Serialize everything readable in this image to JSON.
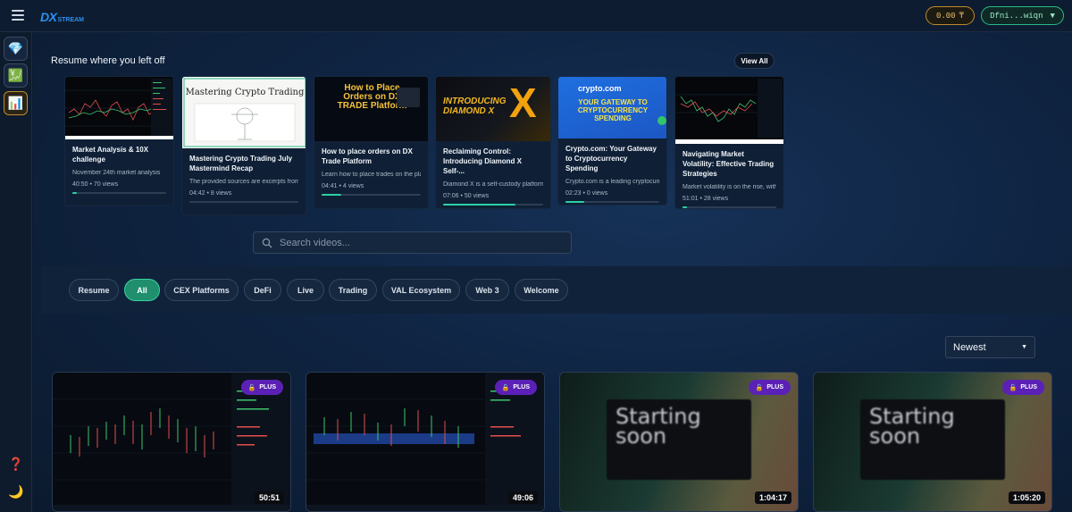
{
  "header": {
    "logo_main": "DX",
    "logo_sub": "STREAM",
    "balance": "0.00",
    "balance_icon": "token-icon",
    "wallet": "Dfni...wiqn",
    "wallet_chevron": "▼"
  },
  "sidebar": {
    "items": [
      {
        "name": "diamond",
        "icon": "💎"
      },
      {
        "name": "chart",
        "icon": "💹"
      },
      {
        "name": "dashboard",
        "icon": "📊"
      }
    ],
    "help_icon": "❓",
    "theme_icon": "🌙"
  },
  "resume": {
    "title": "Resume where you left off",
    "view_all": "View All",
    "cards": [
      {
        "title": "Market Analysis & 10X challenge",
        "desc": "November 24th market analysis",
        "duration": "40:50",
        "views": "70 views",
        "progress": 0.05,
        "thumb_text": ""
      },
      {
        "title": "Mastering Crypto Trading July Mastermind Recap",
        "desc": "The provided sources are excerpts from",
        "duration": "04:42",
        "views": "8 views",
        "progress": 0.0,
        "thumb_text": "Mastering Crypto Trading"
      },
      {
        "title": "How to place orders on DX Trade Platform",
        "desc": "Learn how to place trades on the platform",
        "duration": "04:41",
        "views": "4 views",
        "progress": 0.2,
        "thumb_text": "How to Place Orders on DX TRADE Platform"
      },
      {
        "title": "Reclaiming Control: Introducing Diamond X Self-...",
        "desc": "Diamond X is a self-custody platform",
        "duration": "07:06",
        "views": "50 views",
        "progress": 0.72,
        "thumb_text": "INTRODUCING DIAMOND X"
      },
      {
        "title": "Crypto.com: Your Gateway to Cryptocurrency Spending",
        "desc": "Crypto.com is a leading cryptocurrency",
        "duration": "02:23",
        "views": "0 views",
        "progress": 0.2,
        "thumb_text": "YOUR GATEWAY TO CRYPTOCURRENCY SPENDING"
      },
      {
        "title": "Navigating Market Volatility: Effective Trading Strategies",
        "desc": "Market volatility is on the rise, with",
        "duration": "51:01",
        "views": "28 views",
        "progress": 0.05,
        "thumb_text": ""
      }
    ]
  },
  "search": {
    "placeholder": "Search videos..."
  },
  "filters": [
    "Resume",
    "All",
    "CEX Platforms",
    "DeFi",
    "Live",
    "Trading",
    "VAL Ecosystem",
    "Web 3",
    "Welcome"
  ],
  "active_filter": "All",
  "sort": {
    "selected": "Newest"
  },
  "videos": [
    {
      "badge": "PLUS",
      "duration": "50:51",
      "type": "chart",
      "progress": 0.0
    },
    {
      "badge": "PLUS",
      "duration": "49:06",
      "type": "chart",
      "progress": 0.05
    },
    {
      "badge": "PLUS",
      "duration": "1:04:17",
      "type": "soon",
      "soon_text": "Starting soon",
      "progress": 0.0
    },
    {
      "badge": "PLUS",
      "duration": "1:05:20",
      "type": "soon",
      "soon_text": "Starting soon",
      "progress": 0.06
    }
  ],
  "colors": {
    "accent_green": "#2bd1a4",
    "accent_gold": "#c08a2c",
    "plus_purple": "#5b21b6",
    "brand_blue": "#2e8ff0"
  }
}
